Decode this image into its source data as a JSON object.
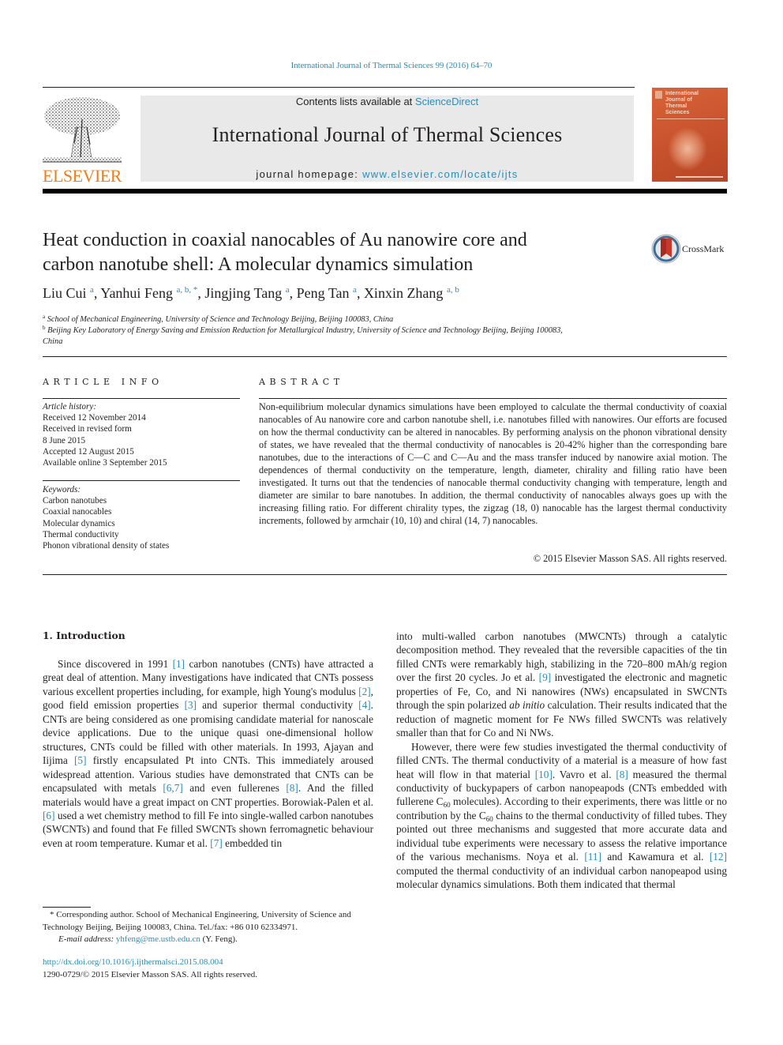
{
  "header": {
    "citation": "International Journal of Thermal Sciences 99 (2016) 64–70",
    "contents_prefix": "Contents lists available at ",
    "contents_link": "ScienceDirect",
    "journal_name": "International Journal of Thermal Sciences",
    "homepage_prefix": "journal homepage: ",
    "homepage_link": "www.elsevier.com/locate/ijts",
    "publisher_logo": "ELSEVIER",
    "cover_title": [
      "International",
      "Journal of",
      "Thermal",
      "Sciences"
    ],
    "colors": {
      "link": "#2a8db8",
      "elsevier_orange": "#f07d1a",
      "cover": "#c5502b"
    }
  },
  "article": {
    "title_line1": "Heat conduction in coaxial nanocables of Au nanowire core and",
    "title_line2": "carbon nanotube shell: A molecular dynamics simulation",
    "crossmark_label": "CrossMark",
    "authors": [
      {
        "name": "Liu Cui",
        "sup": "a"
      },
      {
        "name": "Yanhui Feng",
        "sup": "a, b, *"
      },
      {
        "name": "Jingjing Tang",
        "sup": "a"
      },
      {
        "name": "Peng Tan",
        "sup": "a"
      },
      {
        "name": "Xinxin Zhang",
        "sup": "a, b"
      }
    ],
    "affiliations": [
      {
        "mark": "a",
        "text": "School of Mechanical Engineering, University of Science and Technology Beijing, Beijing 100083, China"
      },
      {
        "mark": "b",
        "text": "Beijing Key Laboratory of Energy Saving and Emission Reduction for Metallurgical Industry, University of Science and Technology Beijing, Beijing 100083,",
        "text_cont": "China"
      }
    ]
  },
  "article_info": {
    "heading": "ARTICLE INFO",
    "history_label": "Article history:",
    "history": [
      "Received 12 November 2014",
      "Received in revised form",
      "8 June 2015",
      "Accepted 12 August 2015",
      "Available online 3 September 2015"
    ],
    "keywords_label": "Keywords:",
    "keywords": [
      "Carbon nanotubes",
      "Coaxial nanocables",
      "Molecular dynamics",
      "Thermal conductivity",
      "Phonon vibrational density of states"
    ]
  },
  "abstract": {
    "heading": "ABSTRACT",
    "text": "Non-equilibrium molecular dynamics simulations have been employed to calculate the thermal conductivity of coaxial nanocables of Au nanowire core and carbon nanotube shell, i.e. nanotubes filled with nanowires. Our efforts are focused on how the thermal conductivity can be altered in nanocables. By performing analysis on the phonon vibrational density of states, we have revealed that the thermal conductivity of nanocables is 20-42% higher than the corresponding bare nanotubes, due to the interactions of C—C and C—Au and the mass transfer induced by nanowire axial motion. The dependences of thermal conductivity on the temperature, length, diameter, chirality and filling ratio have been investigated. It turns out that the tendencies of nanocable thermal conductivity changing with temperature, length and diameter are similar to bare nanotubes. In addition, the thermal conductivity of nanocables always goes up with the increasing filling ratio. For different chirality types, the zigzag (18, 0) nanocable has the largest thermal conductivity increments, followed by armchair (10, 10) and chiral (14, 7) nanocables.",
    "copyright": "© 2015 Elsevier Masson SAS. All rights reserved."
  },
  "introduction": {
    "heading": "1.  Introduction",
    "left_col": [
      {
        "t": "Since discovered in 1991 "
      },
      {
        "ref": "[1]"
      },
      {
        "t": " carbon nanotubes (CNTs) have attracted a great deal of attention. Many investigations have indicated that CNTs possess various excellent properties including, for example, high Young's modulus "
      },
      {
        "ref": "[2]"
      },
      {
        "t": ", good field emission properties "
      },
      {
        "ref": "[3]"
      },
      {
        "t": " and superior thermal conductivity "
      },
      {
        "ref": "[4]"
      },
      {
        "t": ". CNTs are being considered as one promising candidate material for nanoscale device applications. Due to the unique quasi one-dimensional hollow structures, CNTs could be filled with other materials. In 1993, Ajayan and Iijima "
      },
      {
        "ref": "[5]"
      },
      {
        "t": " firstly encapsulated Pt into CNTs. This immediately aroused widespread attention. Various studies have demonstrated that CNTs can be encapsulated with metals "
      },
      {
        "ref": "[6,7]"
      },
      {
        "t": " and even fullerenes "
      },
      {
        "ref": "[8]"
      },
      {
        "t": ". And the filled materials would have a great impact on CNT properties. Borowiak-Palen et al. "
      },
      {
        "ref": "[6]"
      },
      {
        "t": " used a wet chemistry method to fill Fe into single-walled carbon nanotubes (SWCNTs) and found that Fe filled SWCNTs shown ferromagnetic behaviour even at room temperature. Kumar et al. "
      },
      {
        "ref": "[7]"
      },
      {
        "t": " embedded tin"
      }
    ],
    "right_p1": [
      {
        "t": "into multi-walled carbon nanotubes (MWCNTs) through a catalytic decomposition method. They revealed that the reversible capacities of the tin filled CNTs were remarkably high, stabilizing in the 720–800 mAh/g region over the first 20 cycles. Jo et al. "
      },
      {
        "ref": "[9]"
      },
      {
        "t": " investigated the electronic and magnetic properties of Fe, Co, and Ni nanowires (NWs) encapsulated in SWCNTs through the spin polarized "
      },
      {
        "i": "ab initio"
      },
      {
        "t": " calculation. Their results indicated that the reduction of magnetic moment for Fe NWs filled SWCNTs was relatively smaller than that for Co and Ni NWs."
      }
    ],
    "right_p2": [
      {
        "t": "However, there were few studies investigated the thermal conductivity of filled CNTs. The thermal conductivity of a material is a measure of how fast heat will flow in that material "
      },
      {
        "ref": "[10]"
      },
      {
        "t": ". Vavro et al. "
      },
      {
        "ref": "[8]"
      },
      {
        "t": " measured the thermal conductivity of buckypapers of carbon nanopeapods (CNTs embedded with fullerene C"
      },
      {
        "sub": "60"
      },
      {
        "t": " molecules). According to their experiments, there was little or no contribution by the C"
      },
      {
        "sub": "60"
      },
      {
        "t": " chains to the thermal conductivity of filled tubes. They pointed out three mechanisms and suggested that more accurate data and individual tube experiments were necessary to assess the relative importance of the various mechanisms. Noya et al. "
      },
      {
        "ref": "[11]"
      },
      {
        "t": " and Kawamura et al. "
      },
      {
        "ref": "[12]"
      },
      {
        "t": " computed the thermal conductivity of an individual carbon nanopeapod using molecular dynamics simulations. Both them indicated that thermal"
      }
    ]
  },
  "footnote": {
    "corresponding": "* Corresponding author. School of Mechanical Engineering, University of Science and Technology Beijing, Beijing 100083, China. Tel./fax: +86 010 62334971.",
    "email_label": "E-mail address: ",
    "email": "yhfeng@me.ustb.edu.cn",
    "email_suffix": " (Y. Feng).",
    "doi": "http://dx.doi.org/10.1016/j.ijthermalsci.2015.08.004",
    "issn_line": "1290-0729/© 2015 Elsevier Masson SAS. All rights reserved."
  }
}
